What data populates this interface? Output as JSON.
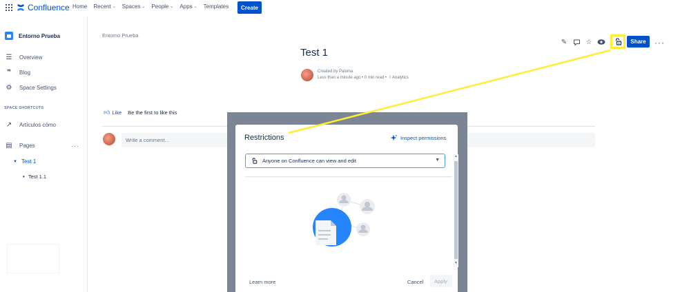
{
  "nav": {
    "logo": "Confluence",
    "items": [
      "Home",
      "Recent",
      "Spaces",
      "People",
      "Apps",
      "Templates"
    ],
    "dropdown_items": [
      false,
      true,
      true,
      true,
      true,
      false
    ],
    "create_label": "Create"
  },
  "sidebar": {
    "space_name": "Entorno Prueba",
    "overview": "Overview",
    "blog": "Blog",
    "space_settings": "Space Settings",
    "shortcuts_heading": "SPACE SHORTCUTS",
    "shortcut_item": "Artículos cómo",
    "pages": "Pages",
    "tree_parent": "Test 1",
    "tree_child": "Test 1.1"
  },
  "page": {
    "breadcrumb": "Entorno Prueba",
    "title": "Test 1",
    "created_by": "Created by Paloma",
    "meta": "Less than a minute ago  •  0 min read  •",
    "analytics": "Analytics",
    "share_label": "Share",
    "like_label": "Like",
    "like_message": "Be the first to like this",
    "comment_placeholder": "Write a comment..."
  },
  "modal": {
    "title": "Restrictions",
    "inspect_label": "Inspect permissions",
    "select_value": "Anyone on Confluence can view and edit",
    "learn_more": "Learn more",
    "cancel": "Cancel",
    "apply": "Apply"
  },
  "colors": {
    "brand": "#0052cc",
    "highlight": "#ffee33",
    "overlay": "#7b8594"
  }
}
